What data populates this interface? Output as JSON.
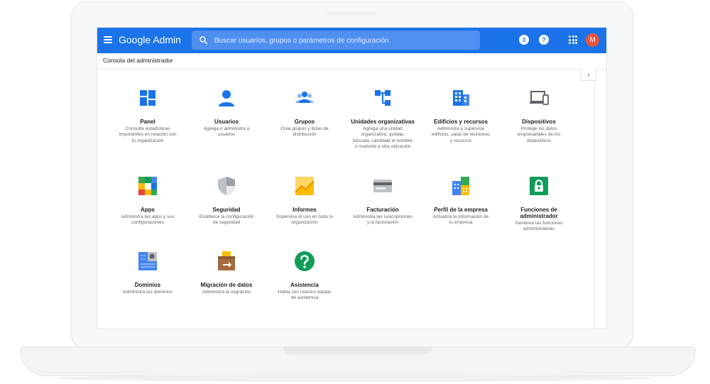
{
  "header": {
    "brand": "Google Admin",
    "search_placeholder": "Buscar usuarios, grupos o parámetros de configuración",
    "notification_count": "3",
    "help_label": "?",
    "avatar_initial": "M"
  },
  "breadcrumb": "Consola del administrador",
  "collapse_label": "‹",
  "colors": {
    "topbar": "#1a73e8",
    "avatar": "#e8543f"
  },
  "tiles": [
    {
      "title": "Panel",
      "desc": "Consulta estadísticas importantes en relación con tu organización",
      "icon": "dashboard-icon"
    },
    {
      "title": "Usuarios",
      "desc": "Agrega o administra a usuarios",
      "icon": "user-icon"
    },
    {
      "title": "Grupos",
      "desc": "Crea grupos y listas de distribución",
      "icon": "groups-icon"
    },
    {
      "title": "Unidades organizativas",
      "desc": "Agrega una unidad organizativa, quítala, búscala, cámbiale el nombre o muévela a otra ubicación",
      "icon": "org-units-icon"
    },
    {
      "title": "Edificios y recursos",
      "desc": "Administra y supervisa edificios, salas de reuniones y recursos",
      "icon": "buildings-icon"
    },
    {
      "title": "Dispositivos",
      "desc": "Protege los datos empresariales de los dispositivos",
      "icon": "devices-icon"
    },
    {
      "title": "Apps",
      "desc": "Administra las apps y sus configuraciones",
      "icon": "apps-icon"
    },
    {
      "title": "Seguridad",
      "desc": "Establece la configuración de seguridad",
      "icon": "shield-icon"
    },
    {
      "title": "Informes",
      "desc": "Supervisa el uso en toda tu organización",
      "icon": "reports-icon"
    },
    {
      "title": "Facturación",
      "desc": "Administra las suscripciones y la facturación",
      "icon": "billing-icon"
    },
    {
      "title": "Perfil de la empresa",
      "desc": "Actualiza la información de tu empresa",
      "icon": "company-profile-icon"
    },
    {
      "title": "Funciones de administrador",
      "desc": "Gestiona las funciones administrativas",
      "icon": "admin-roles-icon"
    },
    {
      "title": "Dominios",
      "desc": "Administra tus dominios",
      "icon": "domains-icon"
    },
    {
      "title": "Migración de datos",
      "desc": "Administra la migración",
      "icon": "data-migration-icon"
    },
    {
      "title": "Asistencia",
      "desc": "Habla con nuestro equipo de asistencia",
      "icon": "support-icon"
    }
  ]
}
